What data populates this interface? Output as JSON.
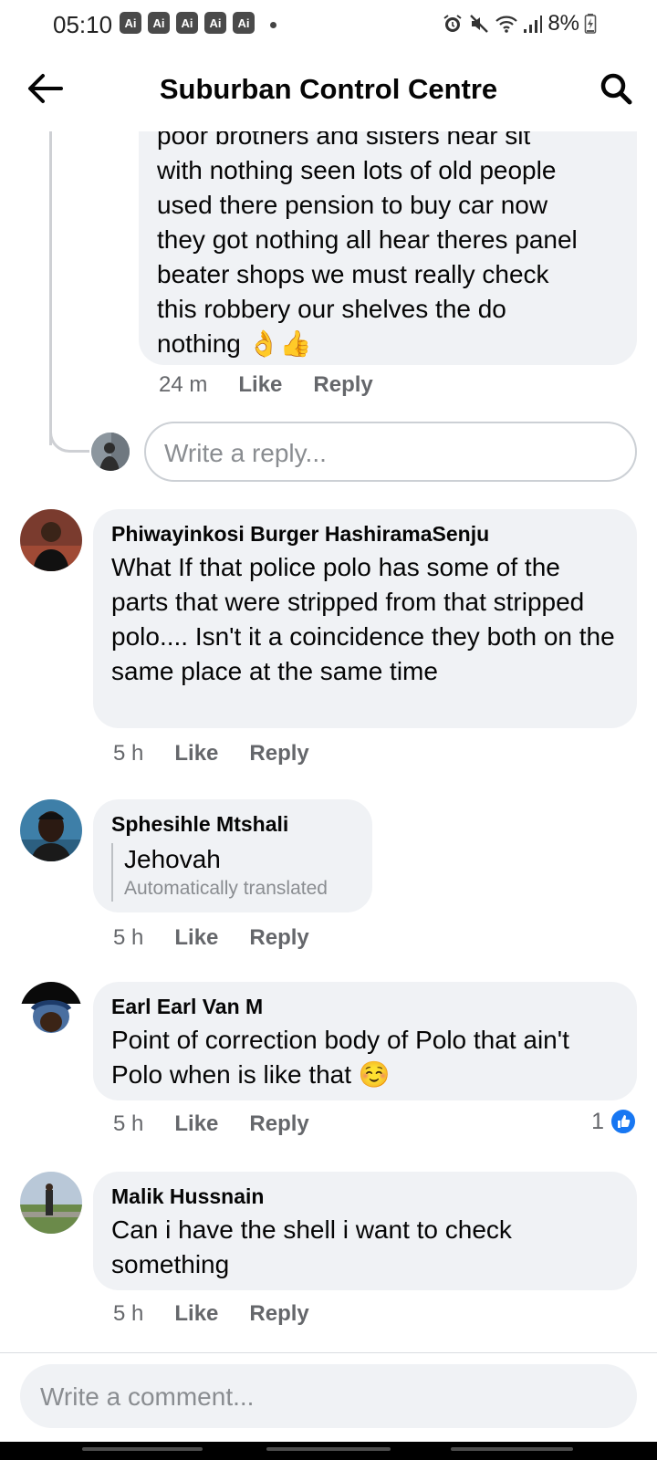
{
  "status_bar": {
    "time": "05:10",
    "ai_badges": [
      "Ai",
      "Ai",
      "Ai",
      "Ai",
      "Ai"
    ],
    "battery": "8%",
    "icons": [
      "alarm-icon",
      "mute-icon",
      "wifi-icon",
      "signal-icon",
      "battery-charging-icon"
    ]
  },
  "header": {
    "title": "Suburban Control Centre",
    "back_icon": "arrow-left-icon",
    "search_icon": "search-icon"
  },
  "thread": {
    "reply_text": "poor brothers and sisters hear sit with nothing seen lots of old people used there pension to buy car now they got nothing all hear theres panel beater shops we must really check this robbery our shelves the do nothing",
    "reply_line_1": "poor brothers and sisters hear sit",
    "reply_line_2": "with nothing seen lots of old people",
    "reply_line_3": "used there pension to buy car now",
    "reply_line_4": "they got nothing all hear theres panel",
    "reply_line_5": "beater shops we must really check",
    "reply_line_6": "this robbery our shelves the do",
    "reply_line_7": "nothing",
    "reply_emoji": "👌👍",
    "reply_age": "24 m",
    "like_label": "Like",
    "reply_label": "Reply",
    "reply_placeholder": "Write a reply..."
  },
  "comments": [
    {
      "author": "Phiwayinkosi Burger HashiramaSenju",
      "text": "What If that police polo has some of the parts that were stripped from that stripped polo.... Isn't it a coincidence they both on the same place at the same time",
      "age": "5 h",
      "like": "Like",
      "reply": "Reply"
    },
    {
      "author": "Sphesihle Mtshali",
      "text": "Jehovah",
      "note": "Automatically translated",
      "age": "5 h",
      "like": "Like",
      "reply": "Reply"
    },
    {
      "author": "Earl Earl Van M",
      "text": "Point of correction body of Polo that ain't Polo when is like that",
      "emoji": "☺️",
      "age": "5 h",
      "like": "Like",
      "reply": "Reply",
      "reaction_count": "1"
    },
    {
      "author": "Malik Hussnain",
      "text": "Can i have the shell i want to check something",
      "age": "5 h",
      "like": "Like",
      "reply": "Reply"
    }
  ],
  "composer": {
    "placeholder": "Write a comment..."
  },
  "colors": {
    "bubble": "#f0f2f5",
    "meta_text": "#65676b",
    "like_blue": "#1877f2"
  }
}
